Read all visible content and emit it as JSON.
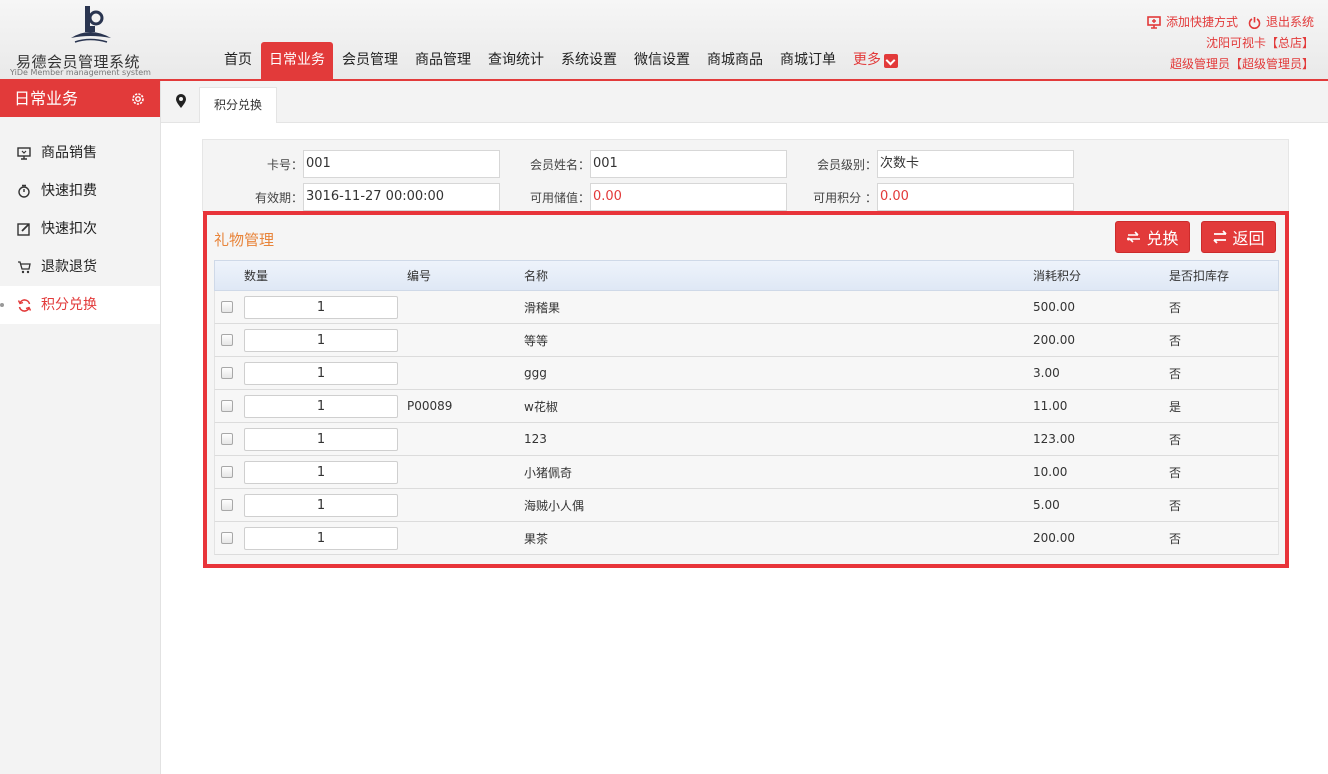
{
  "header": {
    "logo_title": "易德会员管理系统",
    "logo_subtitle": "YiDe Member management system",
    "nav": [
      {
        "label": "首页",
        "active": false
      },
      {
        "label": "日常业务",
        "active": true
      },
      {
        "label": "会员管理",
        "active": false
      },
      {
        "label": "商品管理",
        "active": false
      },
      {
        "label": "查询统计",
        "active": false
      },
      {
        "label": "系统设置",
        "active": false
      },
      {
        "label": "微信设置",
        "active": false
      },
      {
        "label": "商城商品",
        "active": false
      },
      {
        "label": "商城订单",
        "active": false
      }
    ],
    "more_label": "更多",
    "add_shortcut": "添加快捷方式",
    "logout": "退出系统",
    "store": "沈阳可视卡【总店】",
    "user": "超级管理员【超级管理员】"
  },
  "sidebar": {
    "title": "日常业务",
    "items": [
      {
        "label": "商品销售",
        "icon": "monitor-icon"
      },
      {
        "label": "快速扣费",
        "icon": "timer-icon"
      },
      {
        "label": "快速扣次",
        "icon": "edit-icon"
      },
      {
        "label": "退款退货",
        "icon": "cart-return-icon"
      },
      {
        "label": "积分兑换",
        "icon": "refresh-icon",
        "active": true
      }
    ]
  },
  "tabs": [
    {
      "label": "积分兑换"
    }
  ],
  "member": {
    "card_no_label": "卡号：",
    "card_no": "001",
    "name_label": "会员姓名：",
    "name": "001",
    "level_label": "会员级别：",
    "level": "次数卡",
    "expiry_label": "有效期：",
    "expiry": "3016-11-27 00:00:00",
    "balance_label": "可用储值：",
    "balance": "0.00",
    "points_label": "可用积分 ：",
    "points": "0.00"
  },
  "gift": {
    "title": "礼物管理",
    "exchange_button": "兑换",
    "back_button": "返回",
    "columns": [
      "数量",
      "编号",
      "名称",
      "消耗积分",
      "是否扣库存"
    ],
    "rows": [
      {
        "qty": "1",
        "code": "",
        "name": "滑稽果",
        "points": "500.00",
        "deduct": "否"
      },
      {
        "qty": "1",
        "code": "",
        "name": "等等",
        "points": "200.00",
        "deduct": "否"
      },
      {
        "qty": "1",
        "code": "",
        "name": "ggg",
        "points": "3.00",
        "deduct": "否"
      },
      {
        "qty": "1",
        "code": "P00089",
        "name": "w花椒",
        "points": "11.00",
        "deduct": "是"
      },
      {
        "qty": "1",
        "code": "",
        "name": "123",
        "points": "123.00",
        "deduct": "否"
      },
      {
        "qty": "1",
        "code": "",
        "name": "小猪佩奇",
        "points": "10.00",
        "deduct": "否"
      },
      {
        "qty": "1",
        "code": "",
        "name": "海贼小人偶",
        "points": "5.00",
        "deduct": "否"
      },
      {
        "qty": "1",
        "code": "",
        "name": "果茶",
        "points": "200.00",
        "deduct": "否"
      }
    ]
  },
  "colors": {
    "accent": "#e23a3a",
    "title_orange": "#e8843a",
    "highlight_border": "#e8343a"
  }
}
